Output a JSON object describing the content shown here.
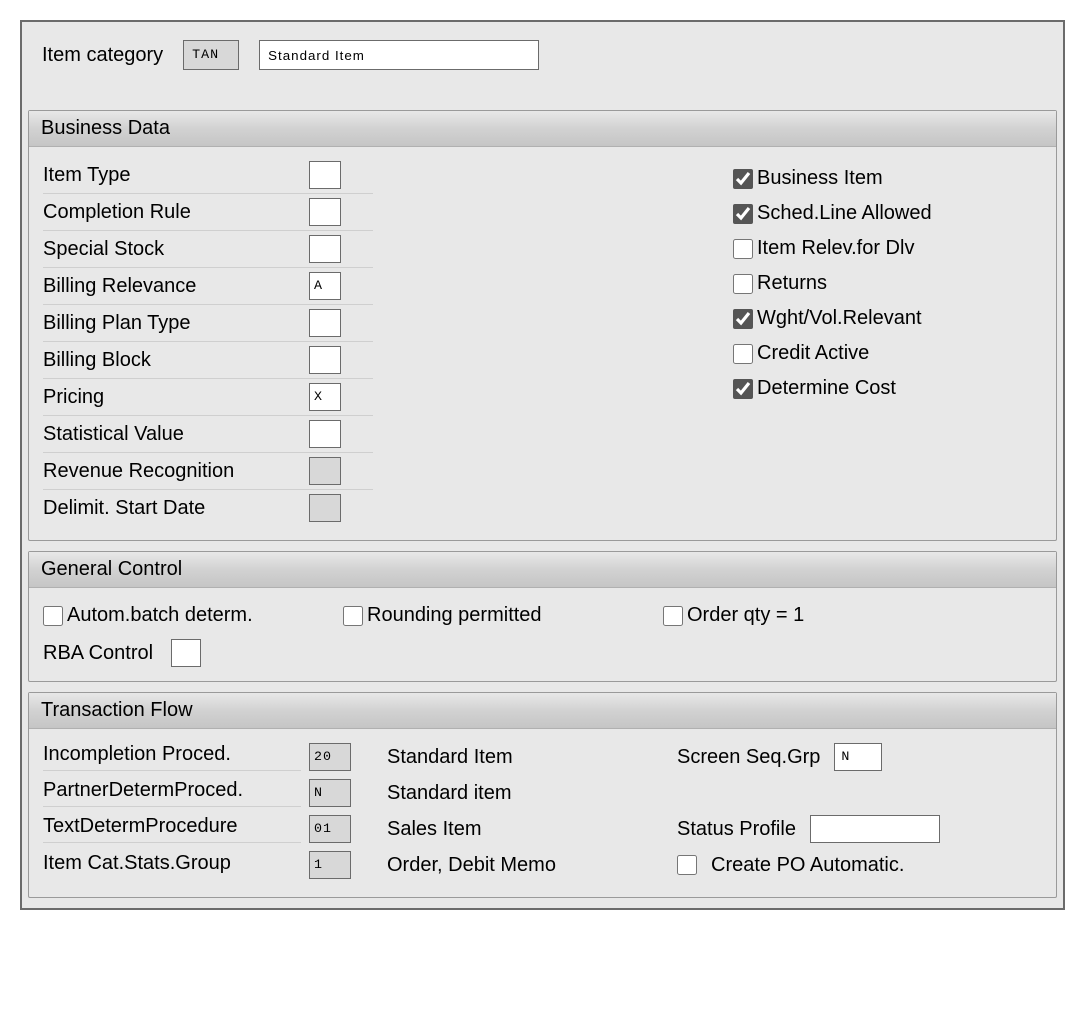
{
  "header": {
    "label": "Item category",
    "code": "TAN",
    "description": "Standard Item"
  },
  "business_data": {
    "title": "Business Data",
    "fields": {
      "item_type": {
        "label": "Item Type",
        "value": ""
      },
      "completion_rule": {
        "label": "Completion Rule",
        "value": ""
      },
      "special_stock": {
        "label": "Special Stock",
        "value": ""
      },
      "billing_relevance": {
        "label": "Billing Relevance",
        "value": "A"
      },
      "billing_plan_type": {
        "label": "Billing Plan Type",
        "value": ""
      },
      "billing_block": {
        "label": "Billing Block",
        "value": ""
      },
      "pricing": {
        "label": "Pricing",
        "value": "X"
      },
      "statistical_value": {
        "label": "Statistical Value",
        "value": ""
      },
      "revenue_recognition": {
        "label": "Revenue Recognition",
        "value": ""
      },
      "delimit_start_date": {
        "label": "Delimit. Start Date",
        "value": ""
      }
    },
    "checks": {
      "business_item": {
        "label": "Business Item",
        "checked": true
      },
      "sched_line_allowed": {
        "label": "Sched.Line Allowed",
        "checked": true
      },
      "item_relev_dlv": {
        "label": "Item Relev.for Dlv",
        "checked": false
      },
      "returns": {
        "label": "Returns",
        "checked": false
      },
      "wght_vol_relevant": {
        "label": "Wght/Vol.Relevant",
        "checked": true
      },
      "credit_active": {
        "label": "Credit Active",
        "checked": false
      },
      "determine_cost": {
        "label": "Determine Cost",
        "checked": true
      }
    }
  },
  "general_control": {
    "title": "General Control",
    "autom_batch": {
      "label": "Autom.batch determ.",
      "checked": false
    },
    "rounding_permitted": {
      "label": "Rounding permitted",
      "checked": false
    },
    "order_qty_1": {
      "label": "Order qty = 1",
      "checked": false
    },
    "rba_control": {
      "label": "RBA Control",
      "value": ""
    }
  },
  "transaction_flow": {
    "title": "Transaction Flow",
    "incompletion_proced": {
      "label": "Incompletion Proced.",
      "value": "20",
      "desc": "Standard Item"
    },
    "partner_determ_proced": {
      "label": "PartnerDetermProced.",
      "value": "N",
      "desc": "Standard item"
    },
    "text_determ_procedure": {
      "label": "TextDetermProcedure",
      "value": "01",
      "desc": "Sales Item"
    },
    "item_cat_stats_group": {
      "label": "Item Cat.Stats.Group",
      "value": "1",
      "desc": "Order, Debit Memo"
    },
    "screen_seq_grp": {
      "label": "Screen Seq.Grp",
      "value": "N"
    },
    "status_profile": {
      "label": "Status Profile",
      "value": ""
    },
    "create_po_automatic": {
      "label": "Create PO Automatic.",
      "checked": false
    }
  }
}
